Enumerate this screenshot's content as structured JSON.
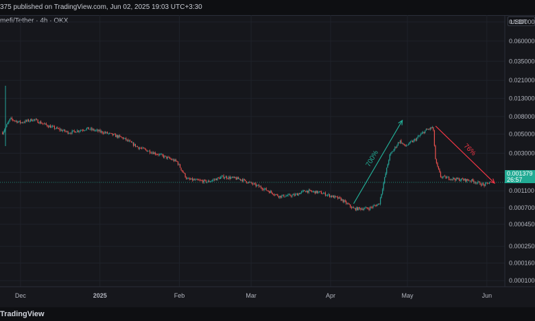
{
  "header": {
    "published": "375 published on TradingView.com, Jun 02, 2025 19:03 UTC+3:30"
  },
  "symbol": {
    "title": "mefi/Tether · 4h · OKX"
  },
  "currency_button": "USDT",
  "colors": {
    "background": "#16171c",
    "up": "#26a69a",
    "down": "#ef5350",
    "up_arrow": "#22ab94",
    "down_arrow": "#f23645"
  },
  "chart_data": {
    "type": "candlestick",
    "title": "",
    "scale": "log",
    "ylim": [
      8.5e-05,
      0.12
    ],
    "y_ticks": [
      "0.100000",
      "0.060000",
      "0.035000",
      "0.021000",
      "0.013000",
      "0.008000",
      "0.005000",
      "0.003000",
      "0.001800",
      "0.001100",
      "0.000700",
      "0.000450",
      "0.000250",
      "0.000160",
      "0.000100"
    ],
    "y_tick_values": [
      0.1,
      0.06,
      0.035,
      0.021,
      0.013,
      0.008,
      0.005,
      0.003,
      0.0018,
      0.0011,
      0.0007,
      0.00045,
      0.00025,
      0.00016,
      0.0001
    ],
    "x_ticks": [
      "Dec",
      "2025",
      "Feb",
      "Mar",
      "Apr",
      "May",
      "Jun"
    ],
    "x_tick_dates": [
      "2024-12-01",
      "2025-01-01",
      "2025-02-01",
      "2025-03-01",
      "2025-04-01",
      "2025-05-01",
      "2025-06-01"
    ],
    "xlim": [
      "2024-11-23",
      "2025-06-08"
    ],
    "last_price": "0.001379",
    "countdown": "26:57",
    "price_path": [
      {
        "date": "2024-11-24",
        "price": 0.0052
      },
      {
        "date": "2024-11-27",
        "price": 0.0075
      },
      {
        "date": "2024-12-01",
        "price": 0.0068
      },
      {
        "date": "2024-12-06",
        "price": 0.0074
      },
      {
        "date": "2024-12-12",
        "price": 0.0062
      },
      {
        "date": "2024-12-20",
        "price": 0.0052
      },
      {
        "date": "2024-12-27",
        "price": 0.0058
      },
      {
        "date": "2025-01-04",
        "price": 0.0051
      },
      {
        "date": "2025-01-10",
        "price": 0.0045
      },
      {
        "date": "2025-01-16",
        "price": 0.0035
      },
      {
        "date": "2025-01-24",
        "price": 0.0029
      },
      {
        "date": "2025-01-31",
        "price": 0.0024
      },
      {
        "date": "2025-02-04",
        "price": 0.0015
      },
      {
        "date": "2025-02-12",
        "price": 0.0014
      },
      {
        "date": "2025-02-18",
        "price": 0.0016
      },
      {
        "date": "2025-02-25",
        "price": 0.0015
      },
      {
        "date": "2025-03-05",
        "price": 0.0012
      },
      {
        "date": "2025-03-12",
        "price": 0.00095
      },
      {
        "date": "2025-03-18",
        "price": 0.00098
      },
      {
        "date": "2025-03-22",
        "price": 0.0011
      },
      {
        "date": "2025-03-28",
        "price": 0.00105
      },
      {
        "date": "2025-04-05",
        "price": 0.00088
      },
      {
        "date": "2025-04-10",
        "price": 0.00068
      },
      {
        "date": "2025-04-16",
        "price": 0.00069
      },
      {
        "date": "2025-04-20",
        "price": 0.00078
      },
      {
        "date": "2025-04-22",
        "price": 0.0015
      },
      {
        "date": "2025-04-24",
        "price": 0.0028
      },
      {
        "date": "2025-04-28",
        "price": 0.0042
      },
      {
        "date": "2025-04-30",
        "price": 0.0036
      },
      {
        "date": "2025-05-04",
        "price": 0.0043
      },
      {
        "date": "2025-05-08",
        "price": 0.0055
      },
      {
        "date": "2025-05-11",
        "price": 0.006
      },
      {
        "date": "2025-05-12",
        "price": 0.0024
      },
      {
        "date": "2025-05-14",
        "price": 0.0016
      },
      {
        "date": "2025-05-20",
        "price": 0.0015
      },
      {
        "date": "2025-05-26",
        "price": 0.00145
      },
      {
        "date": "2025-05-31",
        "price": 0.00128
      },
      {
        "date": "2025-06-02",
        "price": 0.001379
      }
    ],
    "annotations": [
      {
        "text": "700%",
        "color": "#22ab94",
        "from": {
          "date": "2025-04-10",
          "price": 0.00078
        },
        "to": {
          "date": "2025-04-29",
          "price": 0.0072
        }
      },
      {
        "text": "76%",
        "color": "#f23645",
        "from": {
          "date": "2025-05-12",
          "price": 0.0062
        },
        "to": {
          "date": "2025-06-04",
          "price": 0.00135
        }
      }
    ]
  },
  "footer": {
    "brand": "TradingView"
  }
}
